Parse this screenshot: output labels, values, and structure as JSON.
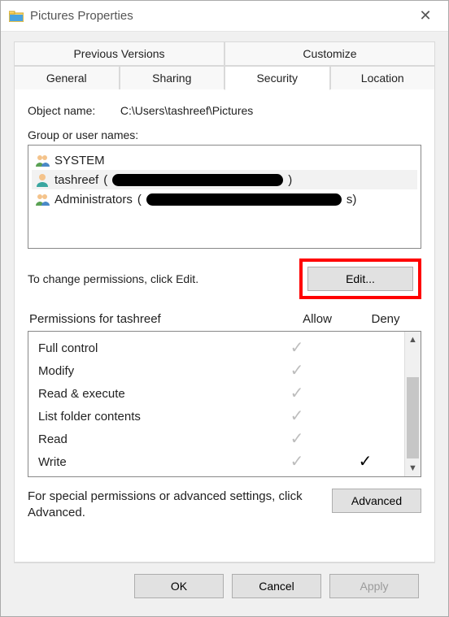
{
  "title": "Pictures Properties",
  "tabs_top": [
    "Previous Versions",
    "Customize"
  ],
  "tabs_bottom": [
    "General",
    "Sharing",
    "Security",
    "Location"
  ],
  "active_tab": "Security",
  "object_name_label": "Object name:",
  "object_name_value": "C:\\Users\\tashreef\\Pictures",
  "group_label": "Group or user names:",
  "groups": [
    {
      "name": "SYSTEM",
      "detail": "",
      "icon": "group",
      "selected": false
    },
    {
      "name": "tashreef",
      "detail": "(redacted)",
      "icon": "user",
      "selected": true
    },
    {
      "name": "Administrators",
      "detail": "(redacted s)",
      "icon": "group",
      "selected": false
    }
  ],
  "edit_hint": "To change permissions, click Edit.",
  "edit_button": "Edit...",
  "perm_header": "Permissions for tashreef",
  "perm_cols": {
    "allow": "Allow",
    "deny": "Deny"
  },
  "permissions": [
    {
      "name": "Full control",
      "allow": "inherited",
      "deny": "none"
    },
    {
      "name": "Modify",
      "allow": "inherited",
      "deny": "none"
    },
    {
      "name": "Read & execute",
      "allow": "inherited",
      "deny": "none"
    },
    {
      "name": "List folder contents",
      "allow": "inherited",
      "deny": "none"
    },
    {
      "name": "Read",
      "allow": "inherited",
      "deny": "none"
    },
    {
      "name": "Write",
      "allow": "inherited",
      "deny": "set"
    }
  ],
  "advanced_hint": "For special permissions or advanced settings, click Advanced.",
  "advanced_button": "Advanced",
  "buttons": {
    "ok": "OK",
    "cancel": "Cancel",
    "apply": "Apply"
  },
  "highlight": "edit"
}
